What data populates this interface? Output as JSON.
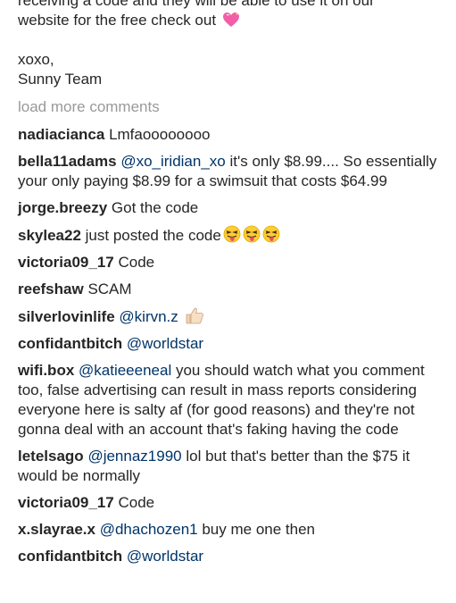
{
  "post": {
    "caption_lines": [
      "receiving a code and they will be able to use it on our",
      "website for the free check out"
    ],
    "caption_emoji": "sparkling-heart-icon",
    "signoff": "xoxo,",
    "signature": "Sunny Team"
  },
  "load_more_label": "load more comments",
  "comments": [
    {
      "user": "nadiacianca",
      "text": "Lmfaoooooooo"
    },
    {
      "user": "bella11adams",
      "mention": "@xo_iridian_xo",
      "text": "it's only $8.99.... So essentially your only paying $8.99 for a swimsuit that costs $64.99"
    },
    {
      "user": "jorge.breezy",
      "text": "Got the code"
    },
    {
      "user": "skylea22",
      "text": "just posted the code",
      "emoji": [
        "face-with-tongue-icon",
        "face-with-tongue-icon",
        "face-with-tongue-icon"
      ]
    },
    {
      "user": "victoria09_17",
      "text": "Code"
    },
    {
      "user": "reefshaw",
      "text": "SCAM"
    },
    {
      "user": "silverlovinlife",
      "mention": "@kirvn.z",
      "emoji": [
        "thumbs-up-icon"
      ]
    },
    {
      "user": "confidantbitch",
      "mention": "@worldstar"
    },
    {
      "user": "wifi.box",
      "mention": "@katieeeneal",
      "text": "you should watch what you comment too, false advertising can result in mass reports considering everyone here is salty af (for good reasons) and they're not gonna deal with an account that's faking having the code"
    },
    {
      "user": "letelsago",
      "mention": "@jennaz1990",
      "text": "lol but that's better than the $75 it would be normally"
    },
    {
      "user": "victoria09_17",
      "text": "Code"
    },
    {
      "user": "x.slayrae.x",
      "mention": "@dhachozen1",
      "text": "buy me one then"
    },
    {
      "user": "confidantbitch",
      "mention": "@worldstar"
    }
  ],
  "colors": {
    "text": "#262626",
    "mention": "#003569",
    "muted": "#999999",
    "background": "#ffffff"
  }
}
